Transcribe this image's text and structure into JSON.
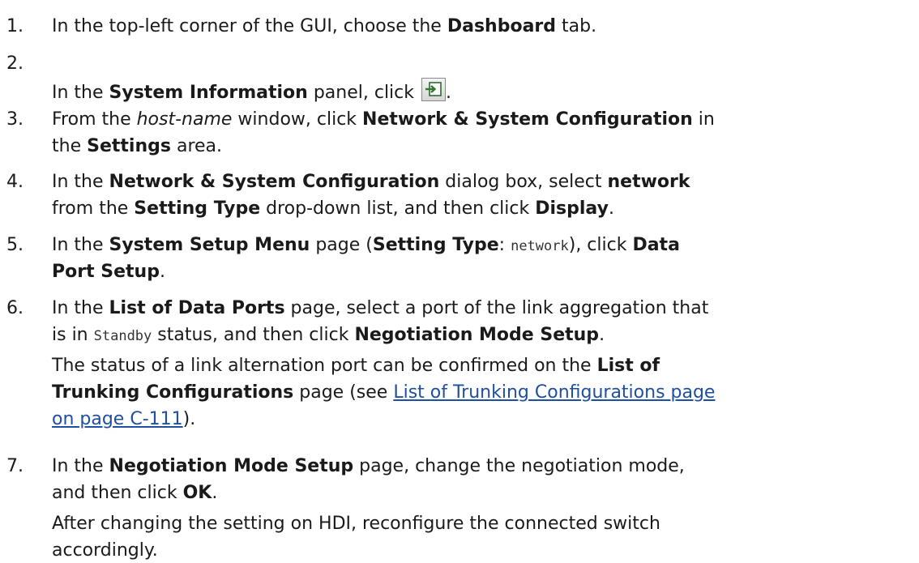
{
  "steps": [
    {
      "number": "1.",
      "lines": [
        [
          {
            "t": "In the top-left corner of the GUI, choose the "
          },
          {
            "t": "Dashboard",
            "s": "b"
          },
          {
            "t": " tab."
          }
        ]
      ]
    },
    {
      "number": "2.",
      "lines": [
        [
          {
            "t": "In the "
          },
          {
            "t": "System Information",
            "s": "b"
          },
          {
            "t": " panel, click "
          },
          {
            "icon": "external-config-icon"
          },
          {
            "t": "."
          }
        ]
      ]
    },
    {
      "number": "3.",
      "lines": [
        [
          {
            "t": "From the "
          },
          {
            "t": "host-name",
            "s": "i"
          },
          {
            "t": " window, click "
          },
          {
            "t": "Network & System Configuration",
            "s": "b"
          },
          {
            "t": " in"
          }
        ],
        [
          {
            "t": "the "
          },
          {
            "t": "Settings",
            "s": "b"
          },
          {
            "t": " area."
          }
        ]
      ]
    },
    {
      "number": "4.",
      "lines": [
        [
          {
            "t": "In the "
          },
          {
            "t": "Network & System Configuration",
            "s": "b"
          },
          {
            "t": " dialog box, select "
          },
          {
            "t": "network",
            "s": "b"
          }
        ],
        [
          {
            "t": "from the "
          },
          {
            "t": "Setting Type",
            "s": "b"
          },
          {
            "t": " drop-down list, and then click "
          },
          {
            "t": "Display",
            "s": "b"
          },
          {
            "t": "."
          }
        ]
      ]
    },
    {
      "number": "5.",
      "lines": [
        [
          {
            "t": "In the "
          },
          {
            "t": "System Setup Menu",
            "s": "b"
          },
          {
            "t": " page ("
          },
          {
            "t": "Setting Type",
            "s": "b"
          },
          {
            "t": ": "
          },
          {
            "t": "network",
            "s": "m"
          },
          {
            "t": "), click "
          },
          {
            "t": "Data",
            "s": "b"
          }
        ],
        [
          {
            "t": "Port Setup",
            "s": "b"
          },
          {
            "t": "."
          }
        ]
      ]
    },
    {
      "number": "6.",
      "lines": [
        [
          {
            "t": "In the "
          },
          {
            "t": "List of Data Ports",
            "s": "b"
          },
          {
            "t": " page, select a port of the link aggregation that"
          }
        ],
        [
          {
            "t": "is in "
          },
          {
            "t": "Standby",
            "s": "m"
          },
          {
            "t": " status, and then click "
          },
          {
            "t": "Negotiation Mode Setup",
            "s": "b"
          },
          {
            "t": "."
          }
        ],
        [
          {
            "t": "The status of a link alternation port can be confirmed on the "
          },
          {
            "t": "List of",
            "s": "b"
          }
        ],
        [
          {
            "t": "Trunking Configurations",
            "s": "b"
          },
          {
            "t": " page (see "
          },
          {
            "t": "List of Trunking Configurations page",
            "s": "a"
          }
        ],
        [
          {
            "t": "on page C-111",
            "s": "a"
          },
          {
            "t": ")."
          }
        ]
      ]
    },
    {
      "number": "7.",
      "lines": [
        [
          {
            "t": "In the "
          },
          {
            "t": "Negotiation Mode Setup",
            "s": "b"
          },
          {
            "t": " page, change the negotiation mode,"
          }
        ],
        [
          {
            "t": "and then click "
          },
          {
            "t": "OK",
            "s": "b"
          },
          {
            "t": "."
          }
        ],
        [
          {
            "t": "After changing the setting on HDI, reconfigure the connected switch"
          }
        ],
        [
          {
            "t": "accordingly."
          }
        ]
      ]
    }
  ]
}
